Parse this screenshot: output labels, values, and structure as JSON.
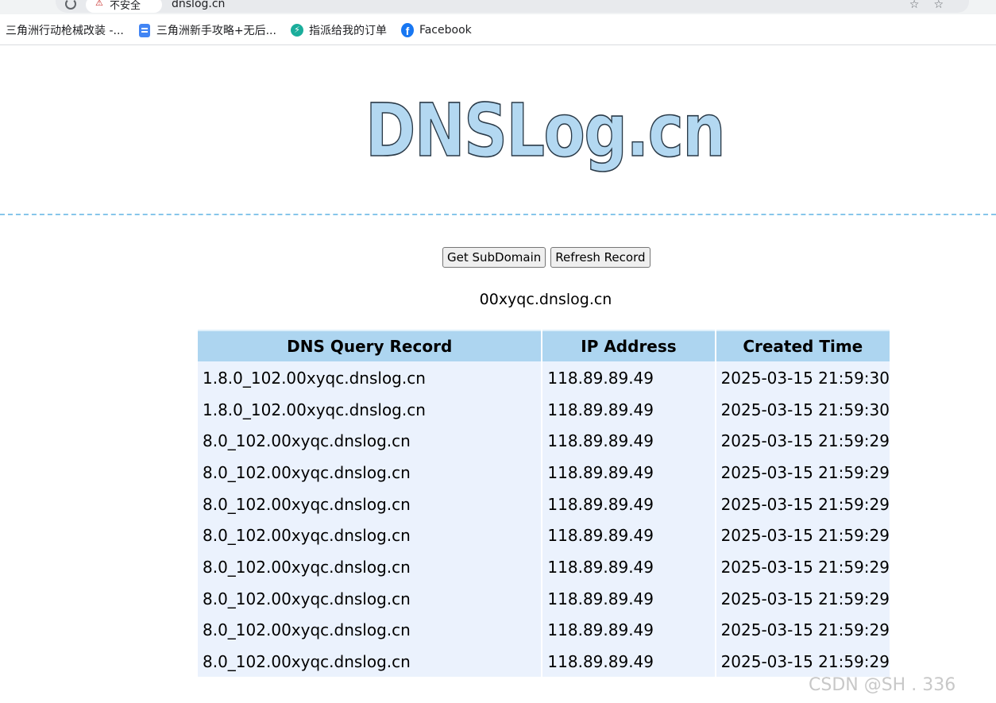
{
  "browser": {
    "url_warning": "不安全",
    "url": "dnslog.cn"
  },
  "bookmarks": [
    {
      "label": "三角洲行动枪械改装 -...",
      "icon": "none"
    },
    {
      "label": "三角洲新手攻略+无后...",
      "icon": "doc-icon"
    },
    {
      "label": "指派给我的订单",
      "icon": "bolt-icon"
    },
    {
      "label": "Facebook",
      "icon": "facebook-icon"
    }
  ],
  "logo": {
    "text": "DNSLog.cn"
  },
  "buttons": {
    "get_subdomain": "Get SubDomain",
    "refresh_record": "Refresh Record"
  },
  "subdomain": "00xyqc.dnslog.cn",
  "table": {
    "headers": [
      "DNS Query Record",
      "IP Address",
      "Created Time"
    ],
    "rows": [
      [
        "1.8.0_102.00xyqc.dnslog.cn",
        "118.89.89.49",
        "2025-03-15 21:59:30"
      ],
      [
        "1.8.0_102.00xyqc.dnslog.cn",
        "118.89.89.49",
        "2025-03-15 21:59:30"
      ],
      [
        "8.0_102.00xyqc.dnslog.cn",
        "118.89.89.49",
        "2025-03-15 21:59:29"
      ],
      [
        "8.0_102.00xyqc.dnslog.cn",
        "118.89.89.49",
        "2025-03-15 21:59:29"
      ],
      [
        "8.0_102.00xyqc.dnslog.cn",
        "118.89.89.49",
        "2025-03-15 21:59:29"
      ],
      [
        "8.0_102.00xyqc.dnslog.cn",
        "118.89.89.49",
        "2025-03-15 21:59:29"
      ],
      [
        "8.0_102.00xyqc.dnslog.cn",
        "118.89.89.49",
        "2025-03-15 21:59:29"
      ],
      [
        "8.0_102.00xyqc.dnslog.cn",
        "118.89.89.49",
        "2025-03-15 21:59:29"
      ],
      [
        "8.0_102.00xyqc.dnslog.cn",
        "118.89.89.49",
        "2025-03-15 21:59:29"
      ],
      [
        "8.0_102.00xyqc.dnslog.cn",
        "118.89.89.49",
        "2025-03-15 21:59:29"
      ]
    ]
  },
  "watermark": "CSDN @SH   . 336",
  "colors": {
    "header_bg": "#add5f0",
    "row_bg": "#ebf2fd",
    "divider": "#87c6ea",
    "logo_fill": "#b3d8f1"
  }
}
